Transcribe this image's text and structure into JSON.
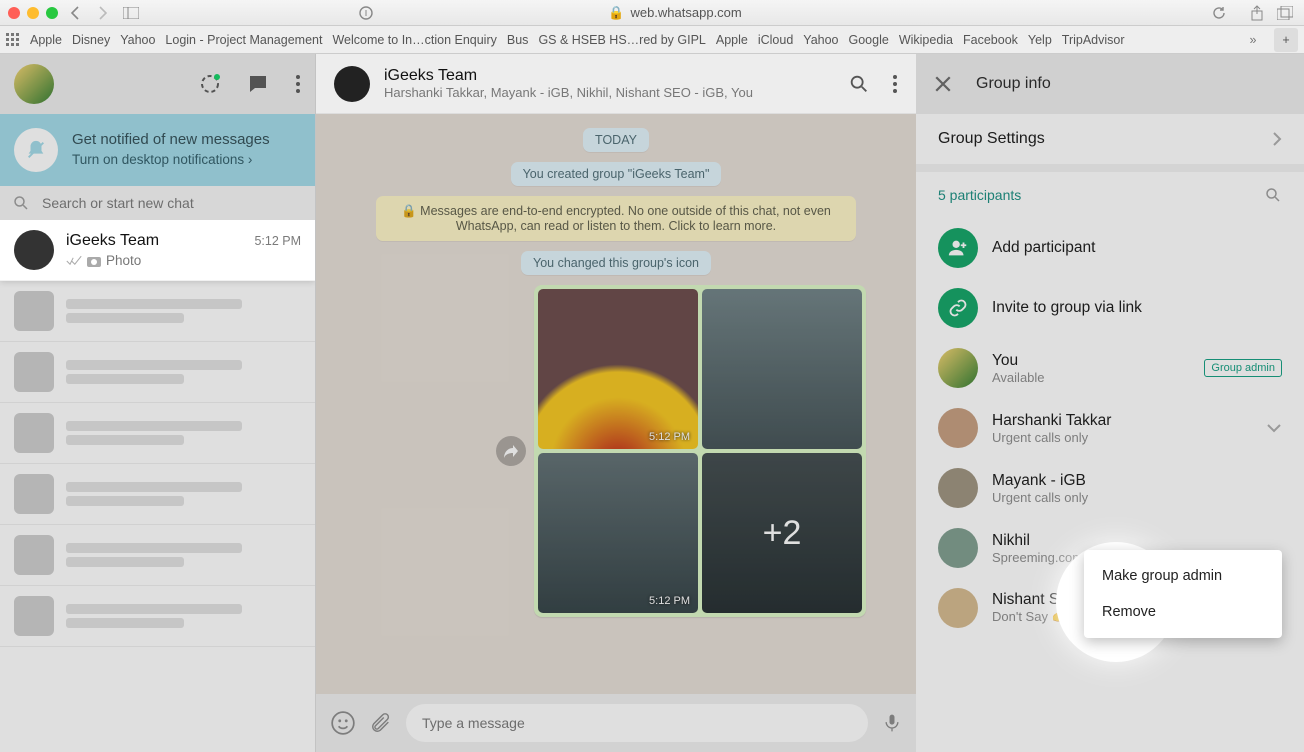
{
  "browser": {
    "url": "web.whatsapp.com",
    "bookmarks": [
      "Apple",
      "Disney",
      "Yahoo",
      "Login - Project Management",
      "Welcome to In…ction Enquiry",
      "Bus",
      "GS & HSEB HS…red by GIPL",
      "Apple",
      "iCloud",
      "Yahoo",
      "Google",
      "Wikipedia",
      "Facebook",
      "Yelp",
      "TripAdvisor"
    ]
  },
  "sidebar": {
    "notif_title": "Get notified of new messages",
    "notif_link": "Turn on desktop notifications",
    "search_placeholder": "Search or start new chat",
    "chat": {
      "name": "iGeeks Team",
      "time": "5:12 PM",
      "subtitle": "Photo"
    }
  },
  "chat": {
    "title": "iGeeks Team",
    "members_line": "Harshanki Takkar, Mayank - iGB, Nikhil, Nishant SEO - iGB, You",
    "date_pill": "TODAY",
    "created_pill": "You created group \"iGeeks Team\"",
    "encrypt_pill": "🔒 Messages are end-to-end encrypted. No one outside of this chat, not even WhatsApp, can read or listen to them. Click to learn more.",
    "icon_pill": "You changed this group's icon",
    "media_time": "5:12 PM",
    "media_more": "+2",
    "compose_placeholder": "Type a message"
  },
  "panel": {
    "title": "Group info",
    "settings": "Group Settings",
    "count_label": "5 participants",
    "add": "Add participant",
    "invite": "Invite to group via link",
    "admin_badge": "Group admin",
    "participants": [
      {
        "name": "You",
        "status": "Available",
        "admin": true
      },
      {
        "name": "Harshanki Takkar",
        "status": "Urgent calls only",
        "chev": true
      },
      {
        "name": "Mayank - iGB",
        "status": "Urgent calls only"
      },
      {
        "name": "Nikhil",
        "status": "Spreeming.com"
      },
      {
        "name": "Nishant SEO - iGB",
        "status": "Don't Say 👉 Hi & Come To The Point ✌️"
      }
    ],
    "menu": {
      "admin": "Make group admin",
      "remove": "Remove"
    }
  }
}
